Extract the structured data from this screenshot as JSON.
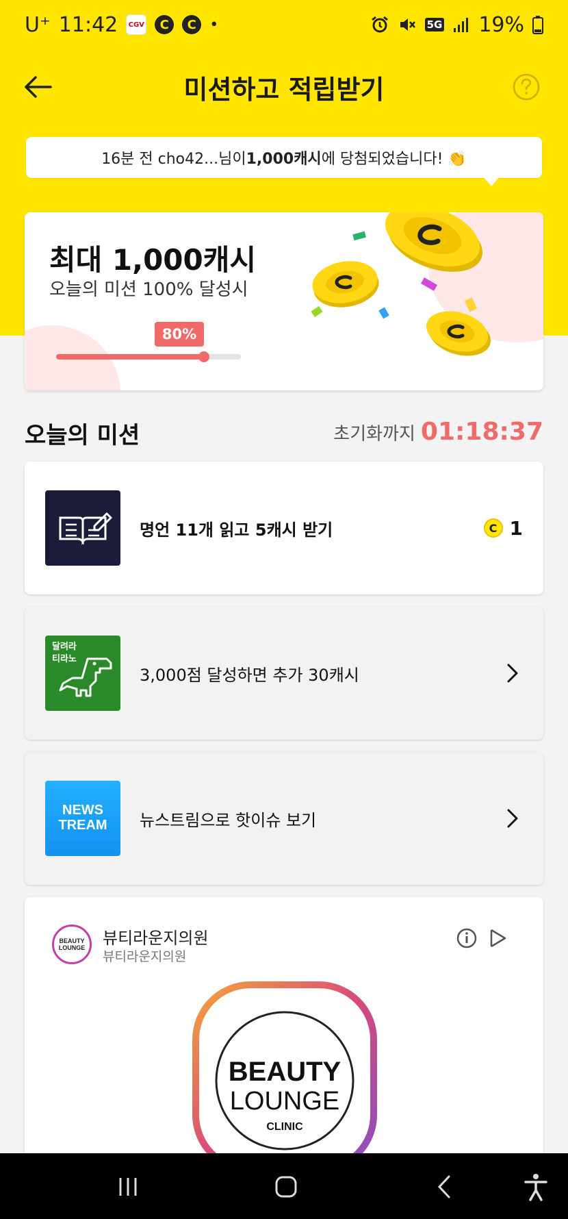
{
  "status_bar": {
    "carrier": "U⁺",
    "time": "11:42",
    "network": "5G",
    "battery": "19%",
    "icons": [
      "cgv-app-icon",
      "c-notification-icon",
      "c-notification-icon",
      "dot-icon",
      "alarm-icon",
      "mute-icon",
      "signal-icon",
      "battery-icon"
    ]
  },
  "header": {
    "title": "미션하고 적립받기",
    "back_icon": "arrow-left-icon",
    "help_icon": "question-circle-icon"
  },
  "winner_banner": {
    "prefix": "16분 전 cho42...님이 ",
    "amount": "1,000캐시",
    "suffix": "에 당첨되었습니다! 👏"
  },
  "reward_card": {
    "title": "최대 1,000캐시",
    "subtitle": "오늘의 미션 100% 달성시",
    "progress_label": "80%",
    "progress_value": 0.8
  },
  "missions_section": {
    "heading": "오늘의 미션",
    "reset_label": "초기화까지",
    "reset_time": "01:18:37"
  },
  "missions": [
    {
      "text": "명언 11개 읽고 5캐시 받기",
      "reward": "1",
      "coin_letter": "C",
      "thumb": "book-pen-icon"
    },
    {
      "text": "3,000점 달성하면 추가 30캐시",
      "thumb_text": [
        "달려라",
        "티라노"
      ],
      "thumb": "dinosaur-icon"
    },
    {
      "text": "뉴스트림으로 핫이슈 보기",
      "thumb_text": [
        "NEWS",
        "TREAM"
      ],
      "thumb": "newstream-logo"
    }
  ],
  "ad": {
    "name": "뷰티라운지의원",
    "sub": "뷰티라운지의원",
    "logo_text": [
      "BEAUTY",
      "LOUNGE",
      "CLINIC"
    ]
  },
  "colors": {
    "brand_yellow": "#ffe500",
    "accent_red": "#f06a6a"
  }
}
